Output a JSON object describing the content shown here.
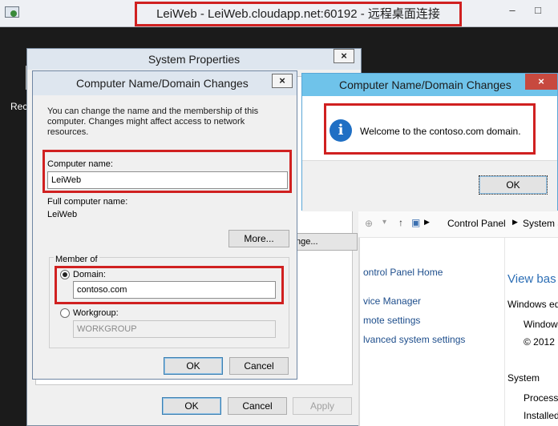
{
  "rdp": {
    "title": "LeiWeb - LeiWeb.cloudapp.net:60192 - 远程桌面连接",
    "minimize": "–",
    "maximize": "□"
  },
  "desktop": {
    "recycle_label": "Rec"
  },
  "system_properties": {
    "title": "System Properties",
    "close": "×",
    "partial_button": "nge...",
    "ok_label": "OK",
    "cancel_label": "Cancel",
    "apply_label": "Apply"
  },
  "cnd": {
    "title": "Computer Name/Domain Changes",
    "close": "×",
    "intro_line1": "You can change the name and the membership of this",
    "intro_line2": "computer. Changes might affect access to network resources.",
    "computer_name_label": "Computer name:",
    "computer_name_value": "LeiWeb",
    "full_name_label": "Full computer name:",
    "full_name_value": "LeiWeb",
    "more_label": "More...",
    "member_of_label": "Member of",
    "domain_label": "Domain:",
    "domain_value": "contoso.com",
    "workgroup_label": "Workgroup:",
    "workgroup_value": "WORKGROUP",
    "ok_label": "OK",
    "cancel_label": "Cancel"
  },
  "welcome": {
    "title": "Computer Name/Domain Changes",
    "close": "×",
    "message": "Welcome to the contoso.com domain.",
    "ok_label": "OK",
    "icon_glyph": "i"
  },
  "control_panel": {
    "breadcrumb_1": "Control Panel",
    "breadcrumb_2": "System a",
    "home_link": "ontrol Panel Home",
    "device_manager": "vice Manager",
    "remote_settings": "mote settings",
    "advanced_settings": "lvanced system settings",
    "view_basic": "View bas",
    "windows_edition": "Windows ed",
    "windows_line": "Window",
    "copyright": "© 2012 I",
    "system_label": "System",
    "processor_label": "Processo",
    "installed_label": "Installed"
  }
}
